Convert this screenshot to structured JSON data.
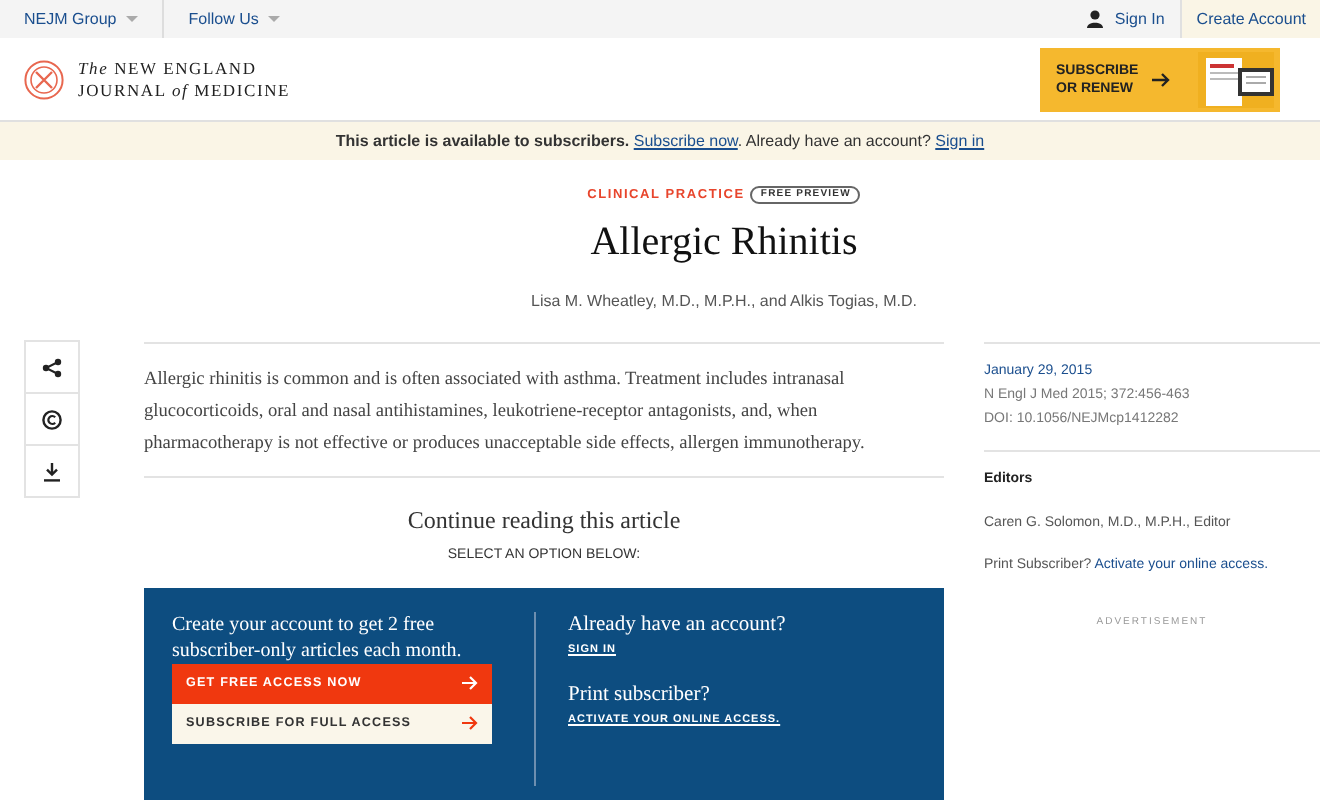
{
  "top_bar": {
    "menus": [
      {
        "label": "NEJM Group"
      },
      {
        "label": "Follow Us"
      }
    ],
    "sign_in": "Sign In",
    "create_account": "Create Account"
  },
  "logo": {
    "lines": [
      "*The* NEW ENGLAND",
      "JOURNAL *of* MEDICINE"
    ]
  },
  "promo": {
    "label": "SUBSCRIBE OR RENEW",
    "kind": "picture"
  },
  "notice": {
    "parts": [
      {
        "kind": "text",
        "text": "**This article is available to subscribers.**"
      },
      {
        "kind": "link",
        "text": "Subscribe now"
      },
      {
        "kind": "text",
        "text": ". Already have an account?"
      },
      {
        "kind": "link",
        "text": "Sign in"
      }
    ]
  },
  "article": {
    "section": "CLINICAL PRACTICE",
    "badge": "FREE PREVIEW",
    "title": "Allergic Rhinitis",
    "authors": "Lisa M. Wheatley, M.D., M.P.H., and Alkis Togias, M.D.",
    "tools": [
      {
        "kind": "share"
      },
      {
        "kind": "copyright"
      },
      {
        "kind": "download"
      }
    ],
    "abstract": "Allergic rhinitis is common and is often associated with asthma. Treatment includes intranasal glucocorticoids, oral and nasal antihistamines, leukotriene-receptor antagonists, and, when pharmacotherapy is not effective or produces unacceptable side effects, allergen immunotherapy.",
    "continue_heading": "Continue reading this article",
    "prompt": "SELECT AN OPTION BELOW:",
    "offer": {
      "text": "Create your account to get 2 free subscriber-only articles each month.",
      "buttons": [
        {
          "kind": "primary",
          "label": "GET FREE ACCESS NOW"
        },
        {
          "kind": "secondary",
          "label": "SUBSCRIBE FOR FULL ACCESS"
        }
      ],
      "options": [
        {
          "question": "Already have an account?",
          "link": "SIGN IN"
        },
        {
          "question": "Print subscriber?",
          "link": "ACTIVATE YOUR ONLINE ACCESS."
        }
      ]
    }
  },
  "sidebar": {
    "date": "January 29, 2015",
    "citation": "N Engl J Med 2015; 372:456-463",
    "doi": "DOI: 10.1056/NEJMcp1412282",
    "editors_heading": "Editors",
    "editor": "Caren G. Solomon, M.D., M.P.H., Editor",
    "print_text": "Print Subscriber?",
    "print_link": "Activate your online access.",
    "advertisement": "ADVERTISEMENT"
  }
}
